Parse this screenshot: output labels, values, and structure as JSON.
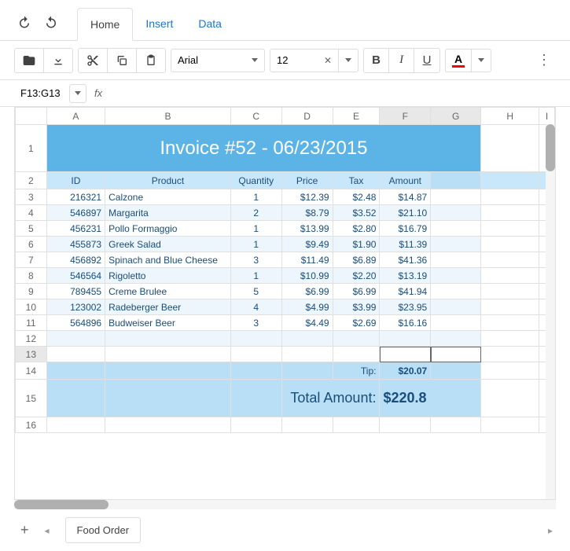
{
  "tabs": {
    "home": "Home",
    "insert": "Insert",
    "data": "Data",
    "active": "Home"
  },
  "toolbar": {
    "font_name": "Arial",
    "font_size": "12",
    "bold": "B",
    "italic": "I",
    "underline": "U",
    "textcolor_letter": "A"
  },
  "formula_bar": {
    "cell_ref": "F13:G13",
    "fx": "fx"
  },
  "columns": [
    "A",
    "B",
    "C",
    "D",
    "E",
    "F",
    "G",
    "H",
    "I"
  ],
  "col_widths": {
    "A": 75,
    "B": 160,
    "C": 65,
    "D": 65,
    "E": 60,
    "F": 65,
    "G": 65,
    "H": 75,
    "I": 20
  },
  "title_cell": "Invoice #52 - 06/23/2015",
  "headers": {
    "id": "ID",
    "product": "Product",
    "quantity": "Quantity",
    "price": "Price",
    "tax": "Tax",
    "amount": "Amount"
  },
  "rows": [
    {
      "id": "216321",
      "product": "Calzone",
      "qty": "1",
      "price": "$12.39",
      "tax": "$2.48",
      "amount": "$14.87"
    },
    {
      "id": "546897",
      "product": "Margarita",
      "qty": "2",
      "price": "$8.79",
      "tax": "$3.52",
      "amount": "$21.10"
    },
    {
      "id": "456231",
      "product": "Pollo Formaggio",
      "qty": "1",
      "price": "$13.99",
      "tax": "$2.80",
      "amount": "$16.79"
    },
    {
      "id": "455873",
      "product": "Greek Salad",
      "qty": "1",
      "price": "$9.49",
      "tax": "$1.90",
      "amount": "$11.39"
    },
    {
      "id": "456892",
      "product": "Spinach and Blue Cheese",
      "qty": "3",
      "price": "$11.49",
      "tax": "$6.89",
      "amount": "$41.36"
    },
    {
      "id": "546564",
      "product": "Rigoletto",
      "qty": "1",
      "price": "$10.99",
      "tax": "$2.20",
      "amount": "$13.19"
    },
    {
      "id": "789455",
      "product": "Creme Brulee",
      "qty": "5",
      "price": "$6.99",
      "tax": "$6.99",
      "amount": "$41.94"
    },
    {
      "id": "123002",
      "product": "Radeberger Beer",
      "qty": "4",
      "price": "$4.99",
      "tax": "$3.99",
      "amount": "$23.95"
    },
    {
      "id": "564896",
      "product": "Budweiser Beer",
      "qty": "3",
      "price": "$4.49",
      "tax": "$2.69",
      "amount": "$16.16"
    }
  ],
  "tip": {
    "label": "Tip:",
    "value": "$20.07"
  },
  "total": {
    "label": "Total Amount:",
    "value": "$220.8"
  },
  "sheet_tab": "Food Order",
  "chart_data": {
    "type": "table",
    "title": "Invoice #52 - 06/23/2015",
    "columns": [
      "ID",
      "Product",
      "Quantity",
      "Price",
      "Tax",
      "Amount"
    ],
    "rows": [
      [
        "216321",
        "Calzone",
        1,
        12.39,
        2.48,
        14.87
      ],
      [
        "546897",
        "Margarita",
        2,
        8.79,
        3.52,
        21.1
      ],
      [
        "456231",
        "Pollo Formaggio",
        1,
        13.99,
        2.8,
        16.79
      ],
      [
        "455873",
        "Greek Salad",
        1,
        9.49,
        1.9,
        11.39
      ],
      [
        "456892",
        "Spinach and Blue Cheese",
        3,
        11.49,
        6.89,
        41.36
      ],
      [
        "546564",
        "Rigoletto",
        1,
        10.99,
        2.2,
        13.19
      ],
      [
        "789455",
        "Creme Brulee",
        5,
        6.99,
        6.99,
        41.94
      ],
      [
        "123002",
        "Radeberger Beer",
        4,
        4.99,
        3.99,
        23.95
      ],
      [
        "564896",
        "Budweiser Beer",
        3,
        4.49,
        2.69,
        16.16
      ]
    ],
    "tip": 20.07,
    "total_amount": 220.8
  }
}
